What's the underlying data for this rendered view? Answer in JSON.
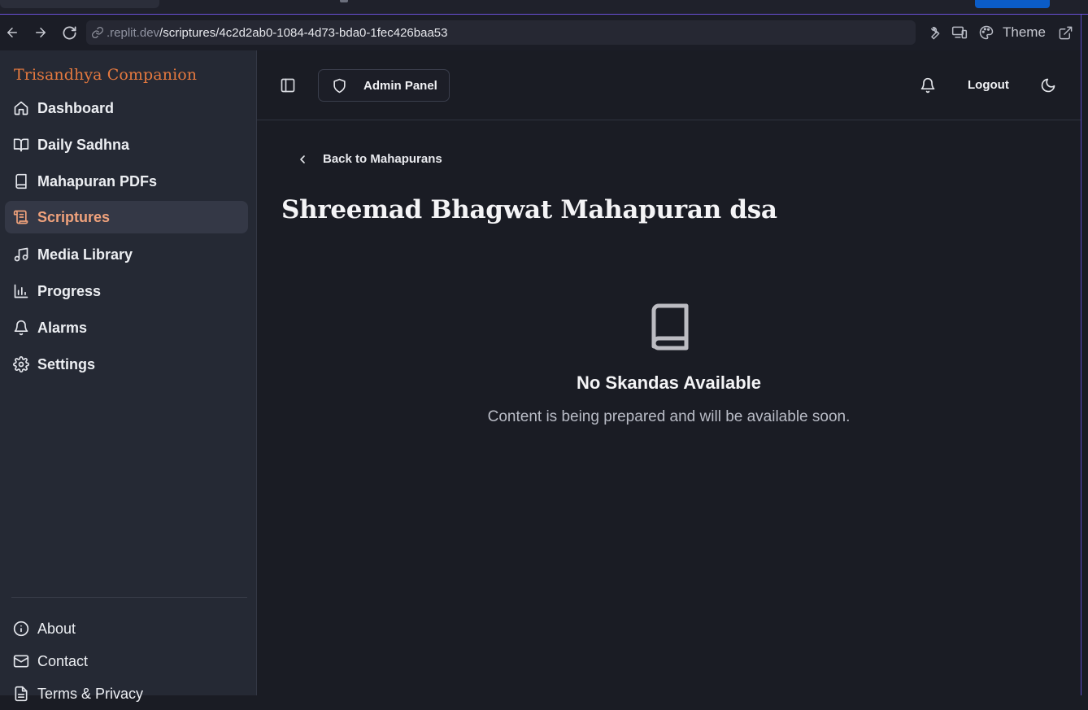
{
  "browser": {
    "url_domain": ".replit.dev",
    "url_path": "/scriptures/4c2d2ab0-1084-4d73-bda0-1fec426baa53",
    "theme_label": "Theme",
    "icons": [
      "back-arrow-icon",
      "forward-arrow-icon",
      "reload-icon",
      "link-icon",
      "wrench-icon",
      "devices-icon",
      "palette-icon",
      "external-link-icon"
    ]
  },
  "sidebar": {
    "brand": "Trisandhya Companion",
    "items": [
      {
        "label": "Dashboard",
        "icon": "home-icon"
      },
      {
        "label": "Daily Sadhna",
        "icon": "open-book-icon"
      },
      {
        "label": "Mahapuran PDFs",
        "icon": "book-icon"
      },
      {
        "label": "Scriptures",
        "icon": "scroll-icon",
        "active": true
      },
      {
        "label": "Media Library",
        "icon": "music-icon"
      },
      {
        "label": "Progress",
        "icon": "bar-chart-icon"
      },
      {
        "label": "Alarms",
        "icon": "bell-icon"
      },
      {
        "label": "Settings",
        "icon": "gear-icon"
      }
    ],
    "footer_items": [
      {
        "label": "About",
        "icon": "info-icon"
      },
      {
        "label": "Contact",
        "icon": "mail-icon"
      },
      {
        "label": "Terms & Privacy",
        "icon": "document-icon"
      }
    ]
  },
  "header": {
    "admin_label": "Admin Panel",
    "logout_label": "Logout"
  },
  "main": {
    "back_label": "Back to Mahapurans",
    "title": "Shreemad Bhagwat Mahapuran dsa",
    "empty_title": "No Skandas Available",
    "empty_message": "Content is being prepared and will be available soon."
  },
  "colors": {
    "brand": "#e5793f",
    "active_text": "#f0a27c",
    "active_bg": "#343846",
    "sidebar_bg": "#252934",
    "main_bg": "#1a1c24"
  }
}
